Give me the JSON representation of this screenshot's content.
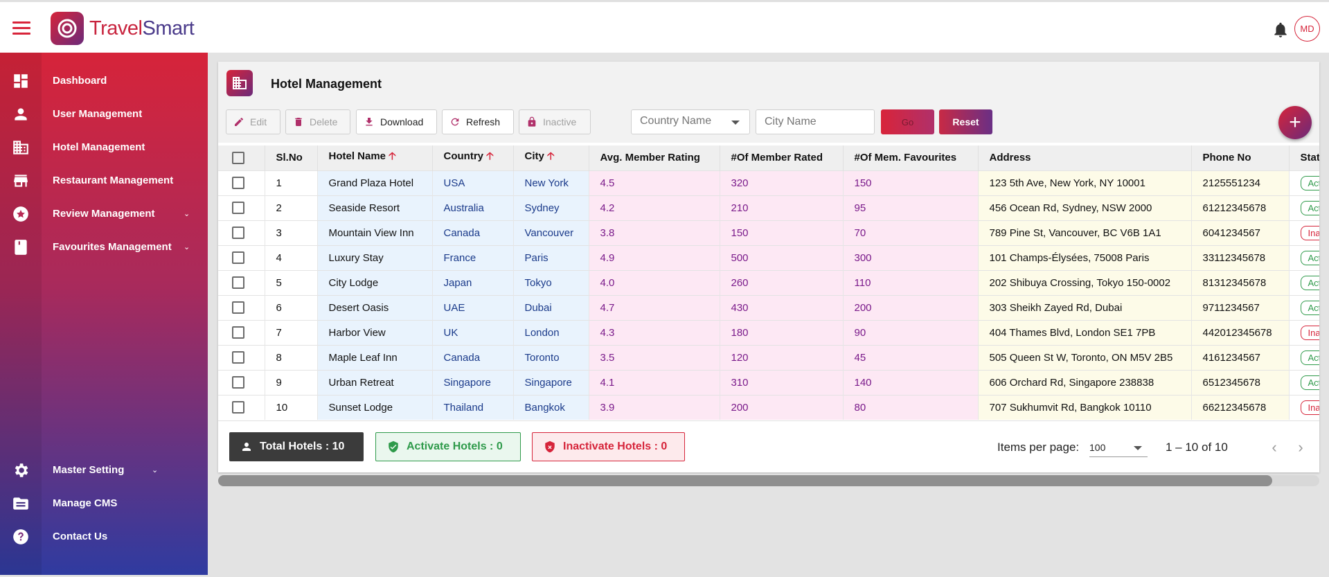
{
  "brand": {
    "name_part1": "Travel",
    "name_part2": "Smart"
  },
  "user": {
    "initials": "MD"
  },
  "sidebar": {
    "items": [
      {
        "label": "Dashboard",
        "icon": "dashboard-icon"
      },
      {
        "label": "User Management",
        "icon": "person-icon"
      },
      {
        "label": "Hotel Management",
        "icon": "hotel-icon"
      },
      {
        "label": "Restaurant Management",
        "icon": "store-icon"
      },
      {
        "label": "Review Management",
        "icon": "star-icon",
        "expandable": true
      },
      {
        "label": "Favourites Management",
        "icon": "bookmark-icon",
        "expandable": true
      }
    ],
    "bottom_items": [
      {
        "label": "Master Setting",
        "icon": "gear-icon",
        "expandable": true
      },
      {
        "label": "Manage CMS",
        "icon": "folder-icon"
      },
      {
        "label": "Contact Us",
        "icon": "help-icon"
      }
    ]
  },
  "page": {
    "title": "Hotel Management"
  },
  "toolbar": {
    "edit": "Edit",
    "delete": "Delete",
    "download": "Download",
    "refresh": "Refresh",
    "inactive": "Inactive",
    "country_placeholder": "Country Name",
    "city_placeholder": "City Name",
    "go": "Go",
    "reset": "Reset"
  },
  "table": {
    "columns": [
      "Sl.No",
      "Hotel Name",
      "Country",
      "City",
      "Avg. Member Rating",
      "#Of Member Rated",
      "#Of Mem. Favourites",
      "Address",
      "Phone No",
      "Status"
    ],
    "rows": [
      {
        "sl": "1",
        "name": "Grand Plaza Hotel",
        "country": "USA",
        "city": "New York",
        "rating": "4.5",
        "rated": "320",
        "fav": "150",
        "address": "123 5th Ave, New York, NY 10001",
        "phone": "2125551234",
        "status": "Active"
      },
      {
        "sl": "2",
        "name": "Seaside Resort",
        "country": "Australia",
        "city": "Sydney",
        "rating": "4.2",
        "rated": "210",
        "fav": "95",
        "address": "456 Ocean Rd, Sydney, NSW 2000",
        "phone": "61212345678",
        "status": "Active"
      },
      {
        "sl": "3",
        "name": "Mountain View Inn",
        "country": "Canada",
        "city": "Vancouver",
        "rating": "3.8",
        "rated": "150",
        "fav": "70",
        "address": "789 Pine St, Vancouver, BC V6B 1A1",
        "phone": "6041234567",
        "status": "Inactive"
      },
      {
        "sl": "4",
        "name": "Luxury Stay",
        "country": "France",
        "city": "Paris",
        "rating": "4.9",
        "rated": "500",
        "fav": "300",
        "address": "101 Champs-Élysées, 75008 Paris",
        "phone": "33112345678",
        "status": "Active"
      },
      {
        "sl": "5",
        "name": "City Lodge",
        "country": "Japan",
        "city": "Tokyo",
        "rating": "4.0",
        "rated": "260",
        "fav": "110",
        "address": "202 Shibuya Crossing, Tokyo 150-0002",
        "phone": "81312345678",
        "status": "Active"
      },
      {
        "sl": "6",
        "name": "Desert Oasis",
        "country": "UAE",
        "city": "Dubai",
        "rating": "4.7",
        "rated": "430",
        "fav": "200",
        "address": "303 Sheikh Zayed Rd, Dubai",
        "phone": "9711234567",
        "status": "Active"
      },
      {
        "sl": "7",
        "name": "Harbor View",
        "country": "UK",
        "city": "London",
        "rating": "4.3",
        "rated": "180",
        "fav": "90",
        "address": "404 Thames Blvd, London SE1 7PB",
        "phone": "442012345678",
        "status": "Inactive"
      },
      {
        "sl": "8",
        "name": "Maple Leaf Inn",
        "country": "Canada",
        "city": "Toronto",
        "rating": "3.5",
        "rated": "120",
        "fav": "45",
        "address": "505 Queen St W, Toronto, ON M5V 2B5",
        "phone": "4161234567",
        "status": "Active"
      },
      {
        "sl": "9",
        "name": "Urban Retreat",
        "country": "Singapore",
        "city": "Singapore",
        "rating": "4.1",
        "rated": "310",
        "fav": "140",
        "address": "606 Orchard Rd, Singapore 238838",
        "phone": "6512345678",
        "status": "Active"
      },
      {
        "sl": "10",
        "name": "Sunset Lodge",
        "country": "Thailand",
        "city": "Bangkok",
        "rating": "3.9",
        "rated": "200",
        "fav": "80",
        "address": "707 Sukhumvit Rd, Bangkok 10110",
        "phone": "66212345678",
        "status": "Inactive"
      }
    ]
  },
  "summary": {
    "total": "Total Hotels : 10",
    "active": "Activate Hotels : 0",
    "inactive": "Inactivate Hotels : 0"
  },
  "pagination": {
    "items_per_page_label": "Items per page:",
    "items_per_page": "100",
    "range": "1 – 10 of 10"
  },
  "colors": {
    "accent_red": "#d6243a",
    "accent_purple": "#6b2a7a",
    "active_green": "#2e9a4a"
  }
}
